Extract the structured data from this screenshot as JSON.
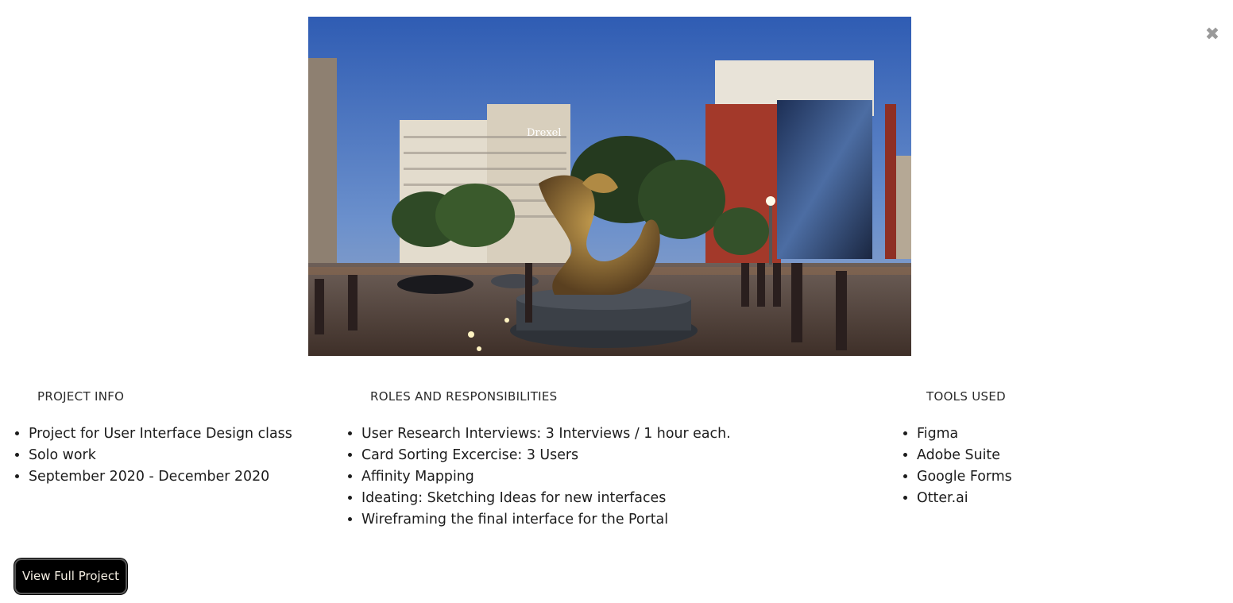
{
  "modal": {
    "close_icon": "close-icon",
    "close_glyph": "✖"
  },
  "hero_image": {
    "description_icon": "dragon-statue-photo",
    "sign_text": "Drexel"
  },
  "project_info": {
    "heading": "PROJECT INFO",
    "items": [
      "Project for User Interface Design class",
      "Solo work",
      "September 2020 - December 2020"
    ]
  },
  "roles": {
    "heading": "ROLES AND RESPONSIBILITIES",
    "items": [
      "User Research Interviews: 3 Interviews / 1 hour each.",
      "Card Sorting Excercise: 3 Users",
      "Affinity Mapping",
      "Ideating: Sketching Ideas for new interfaces",
      "Wireframing the final interface for the Portal"
    ]
  },
  "tools": {
    "heading": "TOOLS USED",
    "items": [
      "Figma",
      "Adobe Suite",
      "Google Forms",
      "Otter.ai"
    ]
  },
  "cta": {
    "label": "View Full Project"
  }
}
